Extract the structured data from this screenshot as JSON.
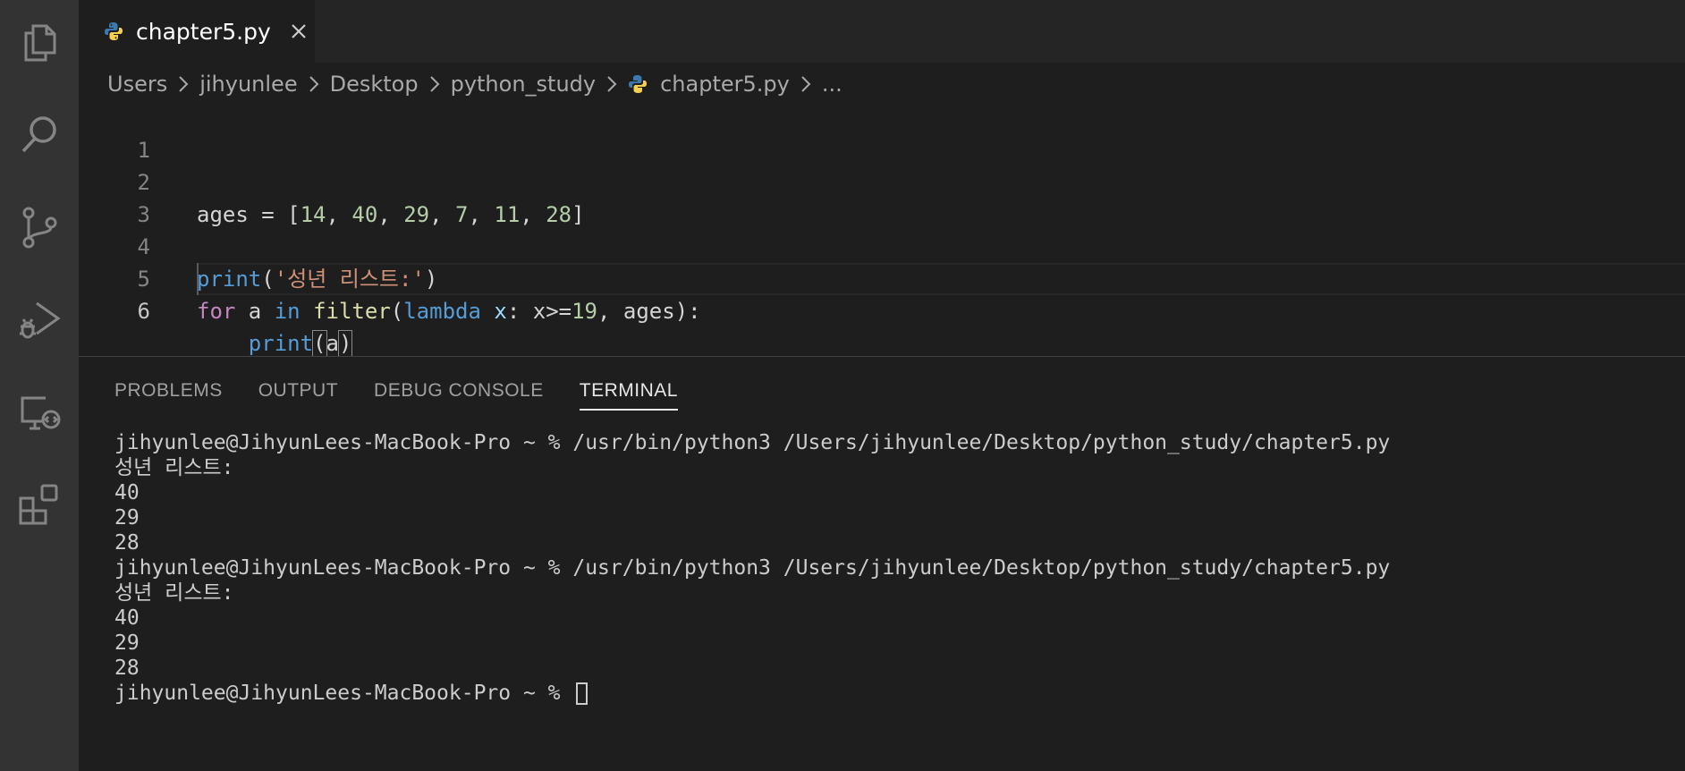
{
  "activity_bar": {
    "items": [
      "files-icon",
      "search-icon",
      "source-control-icon",
      "run-debug-icon",
      "remote-explorer-icon",
      "extensions-icon"
    ]
  },
  "tab": {
    "label": "chapter5.py"
  },
  "breadcrumb": {
    "items": [
      "Users",
      "jihyunlee",
      "Desktop",
      "python_study",
      "chapter5.py"
    ],
    "more": "..."
  },
  "editor": {
    "line_numbers": [
      "1",
      "2",
      "3",
      "4",
      "5",
      "6"
    ],
    "active_line": "6",
    "line2": {
      "p1": "ages = [",
      "n1": "14",
      "c1": ", ",
      "n2": "40",
      "c2": ", ",
      "n3": "29",
      "c3": ", ",
      "n4": "7",
      "c4": ", ",
      "n5": "11",
      "c5": ", ",
      "n6": "28",
      "end": "]"
    },
    "line4": {
      "fn": "print",
      "open": "(",
      "str": "'성년 리스트:'",
      "close": ")"
    },
    "line5": {
      "kw_for": "for",
      "sp1": " a ",
      "kw_in": "in",
      "sp2": " ",
      "fn": "filter",
      "open": "(",
      "kw_lambda": "lambda",
      "sp3": " ",
      "var": "x",
      "mid": ": x>=",
      "num": "19",
      "rest": ", ages):"
    },
    "line6": {
      "indent": "    ",
      "fn": "print",
      "open": "(",
      "arg": "a",
      "close": ")"
    }
  },
  "panel": {
    "tabs": [
      "PROBLEMS",
      "OUTPUT",
      "DEBUG CONSOLE",
      "TERMINAL"
    ],
    "active_tab": "TERMINAL"
  },
  "terminal": {
    "lines": [
      "jihyunlee@JihyunLees-MacBook-Pro ~ % /usr/bin/python3 /Users/jihyunlee/Desktop/python_study/chapter5.py",
      "성년 리스트:",
      "40",
      "29",
      "28",
      "jihyunlee@JihyunLees-MacBook-Pro ~ % /usr/bin/python3 /Users/jihyunlee/Desktop/python_study/chapter5.py",
      "성년 리스트:",
      "40",
      "29",
      "28"
    ],
    "prompt": "jihyunlee@JihyunLees-MacBook-Pro ~ % "
  },
  "colors": {
    "python_blue": "#3b79b0",
    "python_yellow": "#f7d04d",
    "keyword_purple": "#c586c0",
    "function_blue": "#569cd6",
    "number_green": "#b5cea8",
    "string_orange": "#ce9178"
  }
}
